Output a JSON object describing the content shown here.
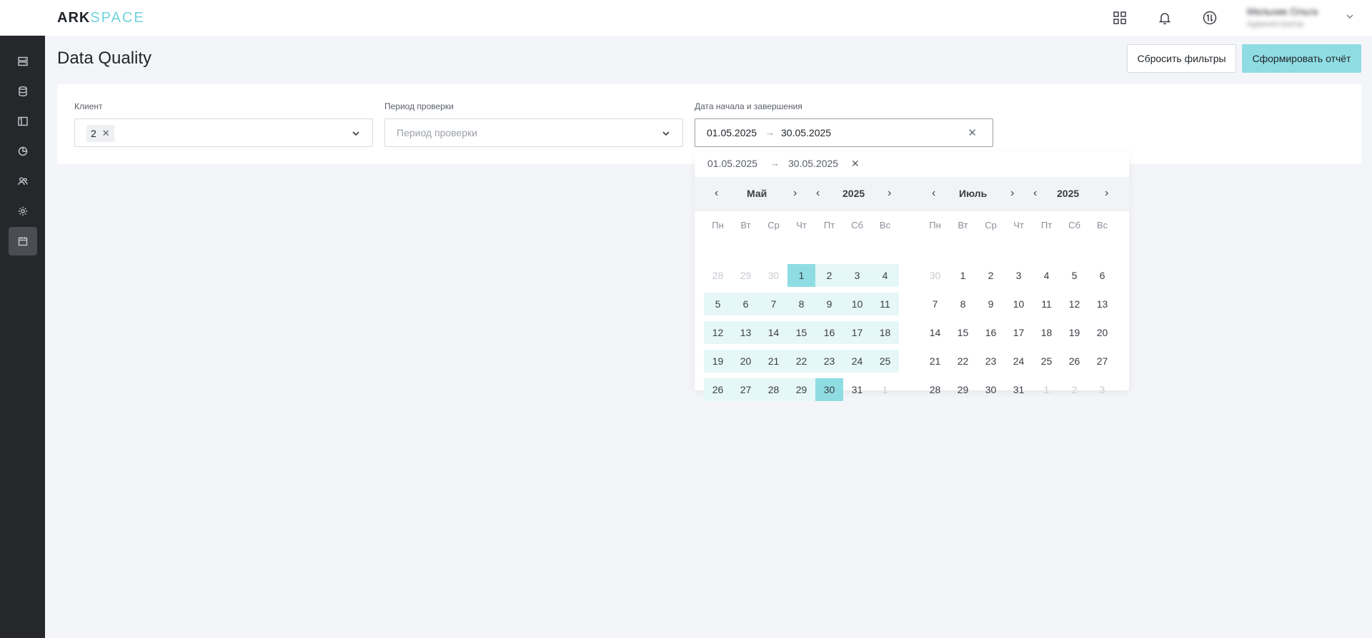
{
  "app": {
    "logo_part1": "ARK",
    "logo_part2": "SPACE",
    "user_name": "Мельник Ольга",
    "user_role": "Администратор"
  },
  "page": {
    "title": "Data Quality",
    "reset_label": "Сбросить фильтры",
    "report_label": "Сформировать отчёт"
  },
  "filters": {
    "client_label": "Клиент",
    "client_tag": "2",
    "period_label": "Период проверки",
    "period_placeholder": "Период проверки",
    "range_label": "Дата начала и завершения",
    "range_start": "01.05.2025",
    "range_end": "30.05.2025"
  },
  "picker": {
    "preset_start": "01.05.2025",
    "preset_end": "30.05.2025",
    "weekdays": [
      "Пн",
      "Вт",
      "Ср",
      "Чт",
      "Пт",
      "Сб",
      "Вс"
    ],
    "left": {
      "month": "Май",
      "year": "2025",
      "days": [
        "28",
        "29",
        "30",
        "1",
        "2",
        "3",
        "4",
        "5",
        "6",
        "7",
        "8",
        "9",
        "10",
        "11",
        "12",
        "13",
        "14",
        "15",
        "16",
        "17",
        "18",
        "19",
        "20",
        "21",
        "22",
        "23",
        "24",
        "25",
        "26",
        "27",
        "28",
        "29",
        "30",
        "31",
        "1"
      ]
    },
    "right": {
      "month": "Июль",
      "year": "2025",
      "days": [
        "30",
        "1",
        "2",
        "3",
        "4",
        "5",
        "6",
        "7",
        "8",
        "9",
        "10",
        "11",
        "12",
        "13",
        "14",
        "15",
        "16",
        "17",
        "18",
        "19",
        "20",
        "21",
        "22",
        "23",
        "24",
        "25",
        "26",
        "27",
        "28",
        "29",
        "30",
        "31",
        "1",
        "2",
        "3"
      ]
    }
  },
  "colors": {
    "accent": "#8fdde3",
    "range_bg": "#e6f7f8",
    "sidebar": "#25272b"
  }
}
